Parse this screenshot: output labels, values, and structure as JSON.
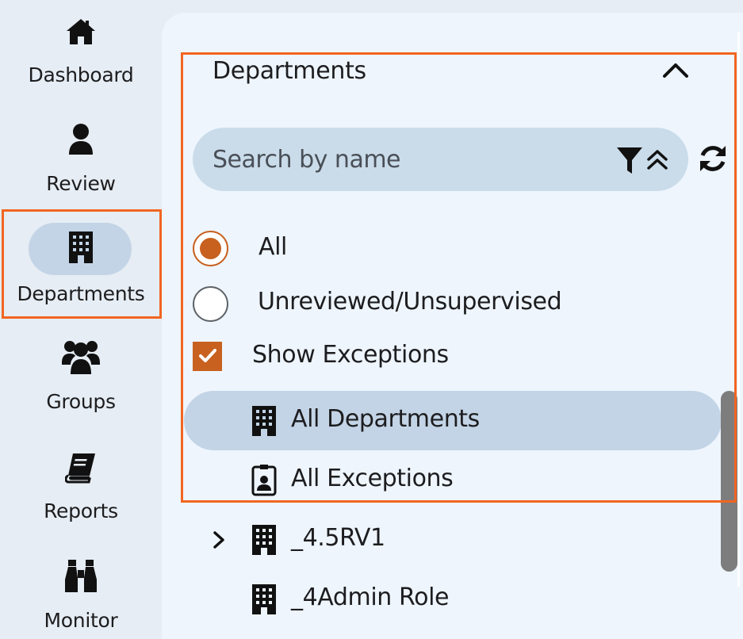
{
  "nav": {
    "items": [
      {
        "label": "Dashboard",
        "icon": "home-icon"
      },
      {
        "label": "Review",
        "icon": "user-icon"
      },
      {
        "label": "Departments",
        "icon": "building-icon",
        "active": true
      },
      {
        "label": "Groups",
        "icon": "users-icon"
      },
      {
        "label": "Reports",
        "icon": "book-icon"
      },
      {
        "label": "Monitor",
        "icon": "binoculars-icon"
      }
    ]
  },
  "panel": {
    "section_title": "Departments",
    "search": {
      "placeholder": "Search by name",
      "value": ""
    },
    "filters": {
      "radio_all": "All",
      "radio_unreviewed": "Unreviewed/Unsupervised",
      "selected": "All",
      "show_exceptions_label": "Show Exceptions",
      "show_exceptions_checked": true
    },
    "list": [
      {
        "label": "All Departments",
        "icon": "building-icon",
        "selected": true
      },
      {
        "label": "All Exceptions",
        "icon": "id-badge-icon"
      },
      {
        "label": "_4.5RV1",
        "icon": "building-icon",
        "expandable": true
      },
      {
        "label": "_4Admin Role",
        "icon": "building-icon"
      }
    ]
  },
  "colors": {
    "accent": "#c8611f",
    "highlight": "#f26522",
    "selected_bg": "#c3d4e6",
    "search_bg": "#cadcea",
    "panel_bg": "#eef5fd"
  }
}
